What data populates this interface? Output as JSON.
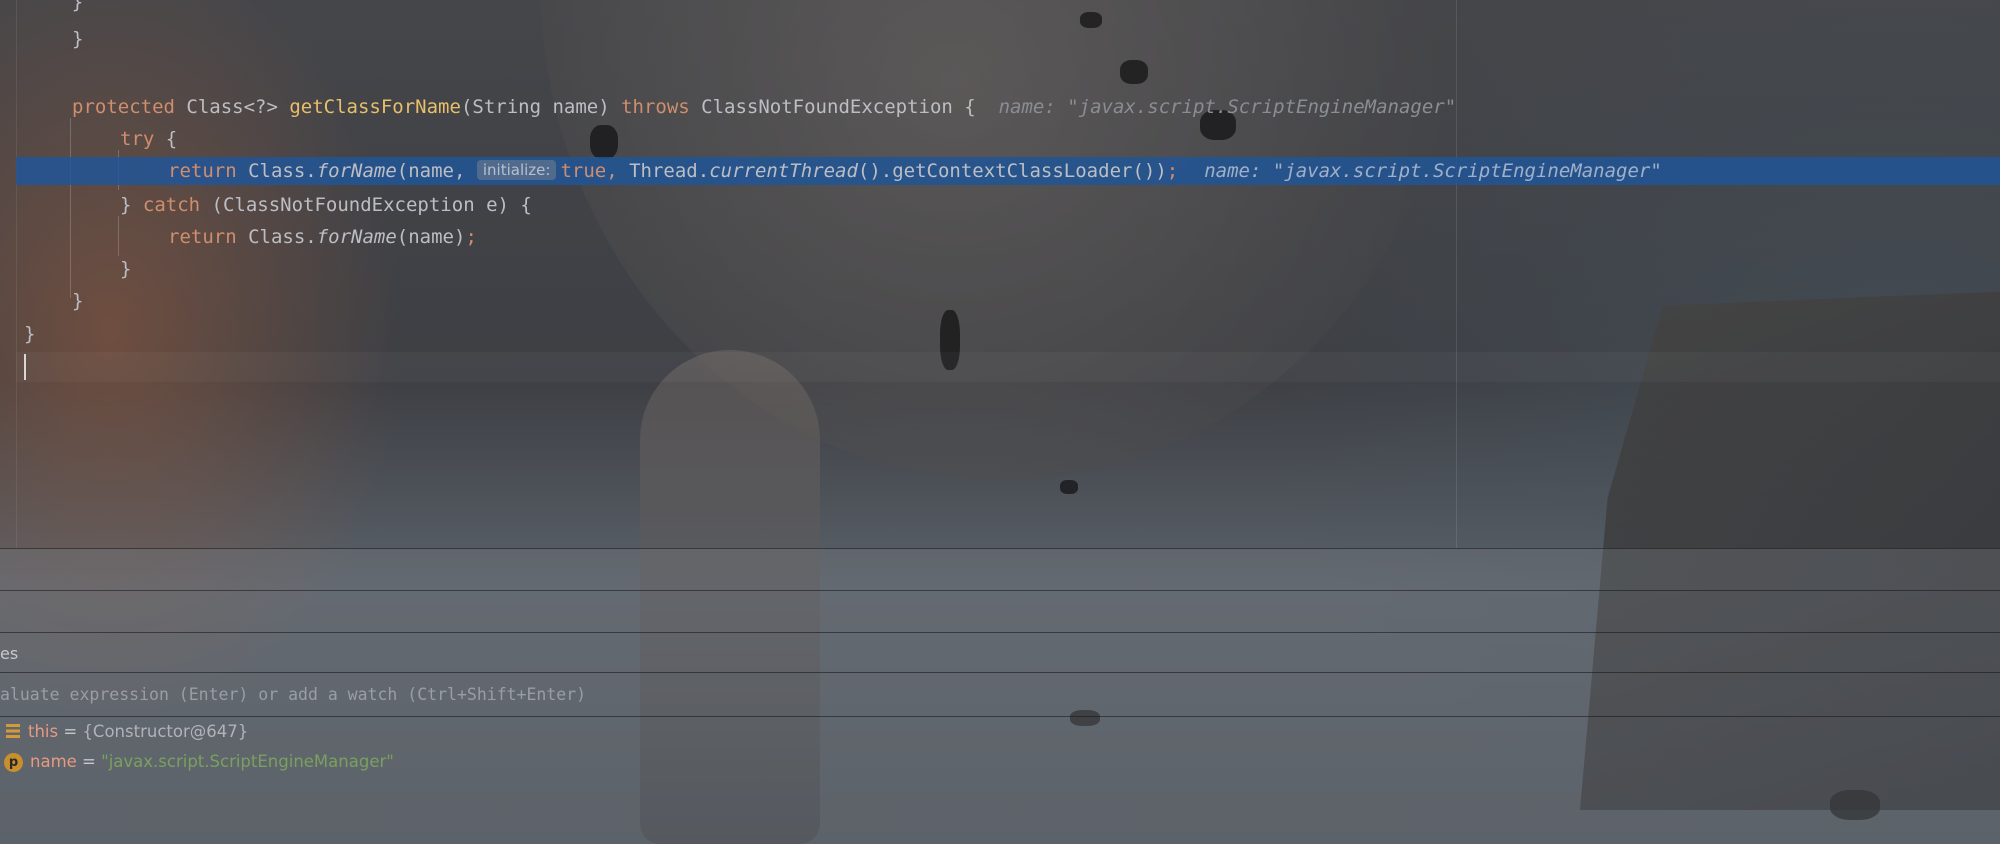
{
  "editor": {
    "lines": [
      {
        "text": "    }"
      },
      {
        "text": "}"
      },
      {
        "protected": "protected ",
        "cls": "Class<?> ",
        "fn": "getClassForName",
        "params": "(String name) ",
        "throws": "throws ",
        "exc": "ClassNotFoundException {  ",
        "hint": "name: \"javax.script.ScriptEngineManager\""
      },
      {
        "try": "try",
        "brace": " {"
      },
      {
        "ret": "return ",
        "cls": "Class.",
        "method": "forName",
        "args": "(name, ",
        "param_hint": "initialize:",
        "true": "true",
        "comma": ", ",
        "thread": "Thread.",
        "ct": "currentThread",
        "rest": "().getContextClassLoader())",
        "semi": ";",
        "hint": "name: \"javax.script.ScriptEngineManager\""
      },
      {
        "open": "} ",
        "catch": "catch",
        "rest": " (ClassNotFoundException e) {"
      },
      {
        "ret": "return ",
        "cls": "Class.",
        "method": "forName",
        "rest": "(name)",
        "semi": ";"
      },
      {
        "text": "}"
      },
      {
        "text": "}"
      },
      {
        "text": "}"
      }
    ]
  },
  "debugger": {
    "tab_label": "es",
    "eval_placeholder": "aluate expression (Enter) or add a watch (Ctrl+Shift+Enter)",
    "variables": [
      {
        "icon": "lines-icon",
        "name": "this",
        "eq": " = ",
        "value": "{Constructor@647}"
      },
      {
        "icon": "parameter-icon",
        "icon_text": "p",
        "name": "name",
        "eq": " = ",
        "value": "\"javax.script.ScriptEngineManager\""
      }
    ]
  },
  "colors": {
    "keyword": "#cf8e6d",
    "function": "#e8bf6a",
    "string": "#7aa060",
    "selection": "#2155a0"
  }
}
